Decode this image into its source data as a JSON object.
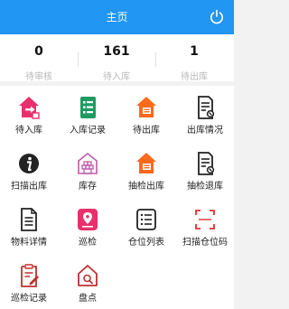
{
  "header": {
    "title": "主页",
    "power_icon": "power-icon"
  },
  "stats": [
    {
      "value": "0",
      "label": "待审核"
    },
    {
      "value": "161",
      "label": "待入库"
    },
    {
      "value": "1",
      "label": "待出库"
    }
  ],
  "menu": [
    {
      "label": "待入库",
      "icon": "inbound-house-icon",
      "color": "#e8306c"
    },
    {
      "label": "入库记录",
      "icon": "record-list-icon",
      "color": "#1e9b61"
    },
    {
      "label": "待出库",
      "icon": "outbound-house-icon",
      "color": "#ff6a1a"
    },
    {
      "label": "出库情况",
      "icon": "document-icon",
      "color": "#222222"
    },
    {
      "label": "扫描出库",
      "icon": "info-icon",
      "color": "#222222"
    },
    {
      "label": "库存",
      "icon": "warehouse-icon",
      "color": "#c05aa8"
    },
    {
      "label": "抽检出库",
      "icon": "check-out-house-icon",
      "color": "#ff6a1a"
    },
    {
      "label": "抽检退库",
      "icon": "document-return-icon",
      "color": "#222222"
    },
    {
      "label": "物料详情",
      "icon": "file-detail-icon",
      "color": "#222222"
    },
    {
      "label": "巡检",
      "icon": "location-icon",
      "color": "#e8306c"
    },
    {
      "label": "仓位列表",
      "icon": "list-icon",
      "color": "#222222"
    },
    {
      "label": "扫描仓位码",
      "icon": "scan-icon",
      "color": "#e03030"
    },
    {
      "label": "巡检记录",
      "icon": "inspection-record-icon",
      "color": "#c03030"
    },
    {
      "label": "盘点",
      "icon": "inventory-house-icon",
      "color": "#c03030"
    }
  ]
}
